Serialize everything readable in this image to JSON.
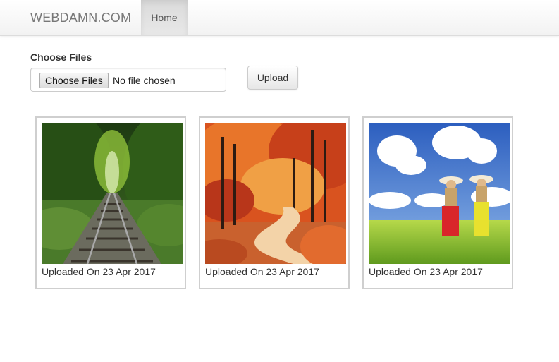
{
  "navbar": {
    "brand": "WEBDAMN.COM",
    "home": "Home"
  },
  "form": {
    "label": "Choose Files",
    "file_button": "Choose Files",
    "file_status": "No file chosen",
    "upload_button": "Upload"
  },
  "gallery": [
    {
      "image": "railway-track-forest-image",
      "caption": "Uploaded On 23 Apr 2017"
    },
    {
      "image": "autumn-forest-path-image",
      "caption": "Uploaded On 23 Apr 2017"
    },
    {
      "image": "girls-in-meadow-image",
      "caption": "Uploaded On 23 Apr 2017"
    }
  ]
}
